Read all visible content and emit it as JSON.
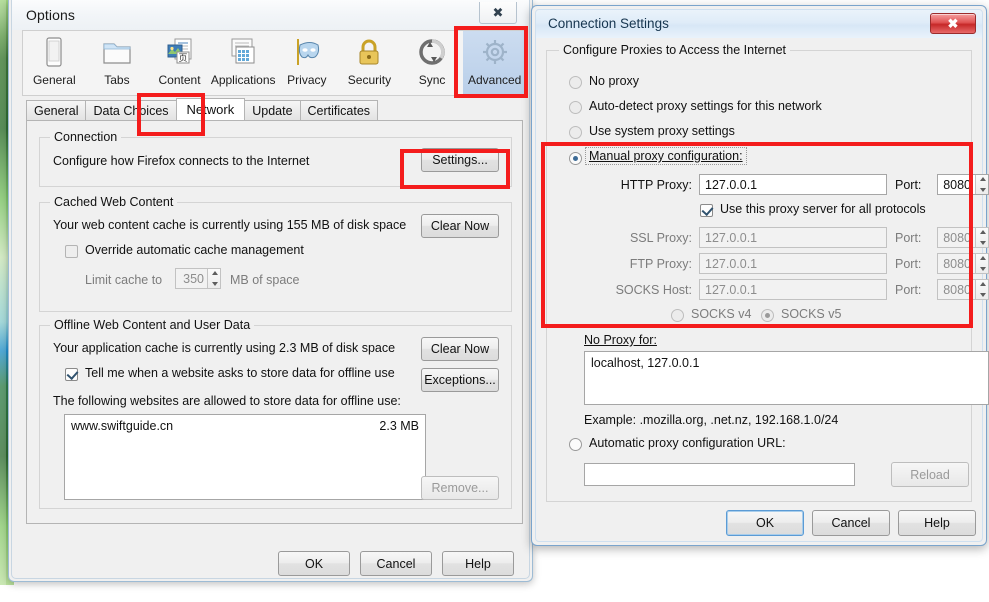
{
  "options_window": {
    "title": "Options",
    "close_label": "✖",
    "categories": [
      {
        "label": "General",
        "icon": "device-icon",
        "selected": false
      },
      {
        "label": "Tabs",
        "icon": "folder-icon",
        "selected": false
      },
      {
        "label": "Content",
        "icon": "content-page-icon",
        "selected": false
      },
      {
        "label": "Applications",
        "icon": "applications-icon",
        "selected": false
      },
      {
        "label": "Privacy",
        "icon": "mask-icon",
        "selected": false
      },
      {
        "label": "Security",
        "icon": "lock-icon",
        "selected": false
      },
      {
        "label": "Sync",
        "icon": "sync-icon",
        "selected": false
      },
      {
        "label": "Advanced",
        "icon": "gear-icon",
        "selected": true
      }
    ],
    "tabs": [
      {
        "label": "General",
        "active": false
      },
      {
        "label": "Data Choices",
        "active": false
      },
      {
        "label": "Network",
        "active": true
      },
      {
        "label": "Update",
        "active": false
      },
      {
        "label": "Certificates",
        "active": false
      }
    ],
    "connection_group": {
      "title": "Connection",
      "description": "Configure how Firefox connects to the Internet",
      "settings_button": "Settings..."
    },
    "cache_group": {
      "title": "Cached Web Content",
      "description": "Your web content cache is currently using 155 MB of disk space",
      "clear_button": "Clear Now",
      "override_checkbox": "Override automatic cache management",
      "override_checked": false,
      "limit_label": "Limit cache to",
      "limit_value": "350",
      "limit_suffix": "MB of space"
    },
    "offline_group": {
      "title": "Offline Web Content and User Data",
      "description": "Your application cache is currently using 2.3 MB of disk space",
      "clear_button": "Clear Now",
      "exceptions_button": "Exceptions...",
      "tell_me_checkbox": "Tell me when a website asks to store data for offline use",
      "tell_me_checked": true,
      "list_label": "The following websites are allowed to store data for offline use:",
      "sites": [
        {
          "name": "www.swiftguide.cn",
          "size": "2.3 MB"
        }
      ],
      "remove_button": "Remove..."
    },
    "footer": {
      "ok": "OK",
      "cancel": "Cancel",
      "help": "Help"
    }
  },
  "connection_dialog": {
    "title": "Connection Settings",
    "close_label": "✖",
    "group_title": "Configure Proxies to Access the Internet",
    "radios": [
      {
        "label": "No proxy",
        "selected": false
      },
      {
        "label": "Auto-detect proxy settings for this network",
        "selected": false
      },
      {
        "label": "Use system proxy settings",
        "selected": false
      },
      {
        "label": "Manual proxy configuration:",
        "selected": true
      }
    ],
    "manual": {
      "rows": [
        {
          "label": "HTTP Proxy:",
          "value": "127.0.0.1",
          "port_label": "Port:",
          "port": "8080",
          "disabled": false
        },
        {
          "label": "SSL Proxy:",
          "value": "127.0.0.1",
          "port_label": "Port:",
          "port": "8080",
          "disabled": true
        },
        {
          "label": "FTP Proxy:",
          "value": "127.0.0.1",
          "port_label": "Port:",
          "port": "8080",
          "disabled": true
        },
        {
          "label": "SOCKS Host:",
          "value": "127.0.0.1",
          "port_label": "Port:",
          "port": "8080",
          "disabled": true
        }
      ],
      "all_protocols_checkbox": "Use this proxy server for all protocols",
      "all_protocols_checked": true,
      "socks_v4": "SOCKS v4",
      "socks_v5": "SOCKS v5",
      "socks_version_selected": "SOCKS v5"
    },
    "no_proxy": {
      "label": "No Proxy for:",
      "value": "localhost, 127.0.0.1",
      "example": "Example: .mozilla.org, .net.nz, 192.168.1.0/24"
    },
    "auto_config": {
      "radio_label": "Automatic proxy configuration URL:",
      "selected": false,
      "url_value": "",
      "reload_button": "Reload"
    },
    "footer": {
      "ok": "OK",
      "cancel": "Cancel",
      "help": "Help"
    }
  },
  "annotations": {
    "highlight_color": "#f41c1c",
    "boxes": [
      "advanced-category",
      "network-tab",
      "settings-button",
      "manual-proxy-configuration-section"
    ]
  }
}
